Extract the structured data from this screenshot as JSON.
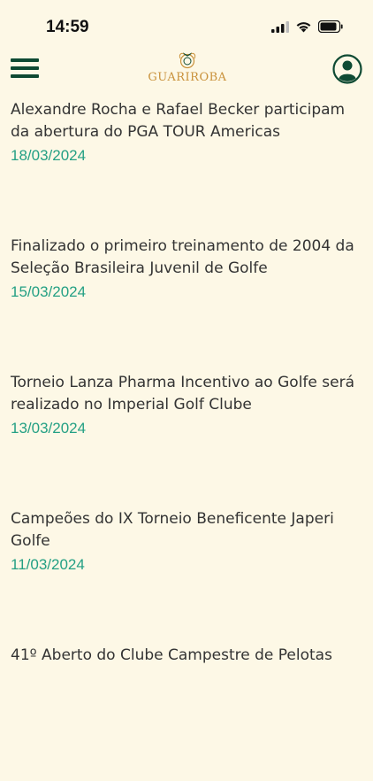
{
  "status_bar": {
    "time": "14:59"
  },
  "header": {
    "logo_text": "GUARIROBA"
  },
  "news": [
    {
      "title": "Alexandre Rocha e Rafael Becker participam da abertura do PGA TOUR Americas",
      "date": "18/03/2024"
    },
    {
      "title": "Finalizado o primeiro treinamento de 2004 da Seleção Brasileira Juvenil de Golfe",
      "date": "15/03/2024"
    },
    {
      "title": "Torneio Lanza Pharma Incentivo ao Golfe será realizado no Imperial Golf Clube",
      "date": "13/03/2024"
    },
    {
      "title": "Campeões do IX Torneio Beneficente Japeri Golfe",
      "date": "11/03/2024"
    },
    {
      "title": "41º Aberto do Clube Campestre de Pelotas",
      "date": ""
    }
  ],
  "colors": {
    "background": "#fdf8e6",
    "primary": "#0e4a33",
    "accent_gold": "#c9913a",
    "date": "#24a084"
  },
  "icons": [
    "menu-icon",
    "logo-crest-icon",
    "user-profile-icon",
    "signal-icon",
    "wifi-icon",
    "battery-icon"
  ]
}
